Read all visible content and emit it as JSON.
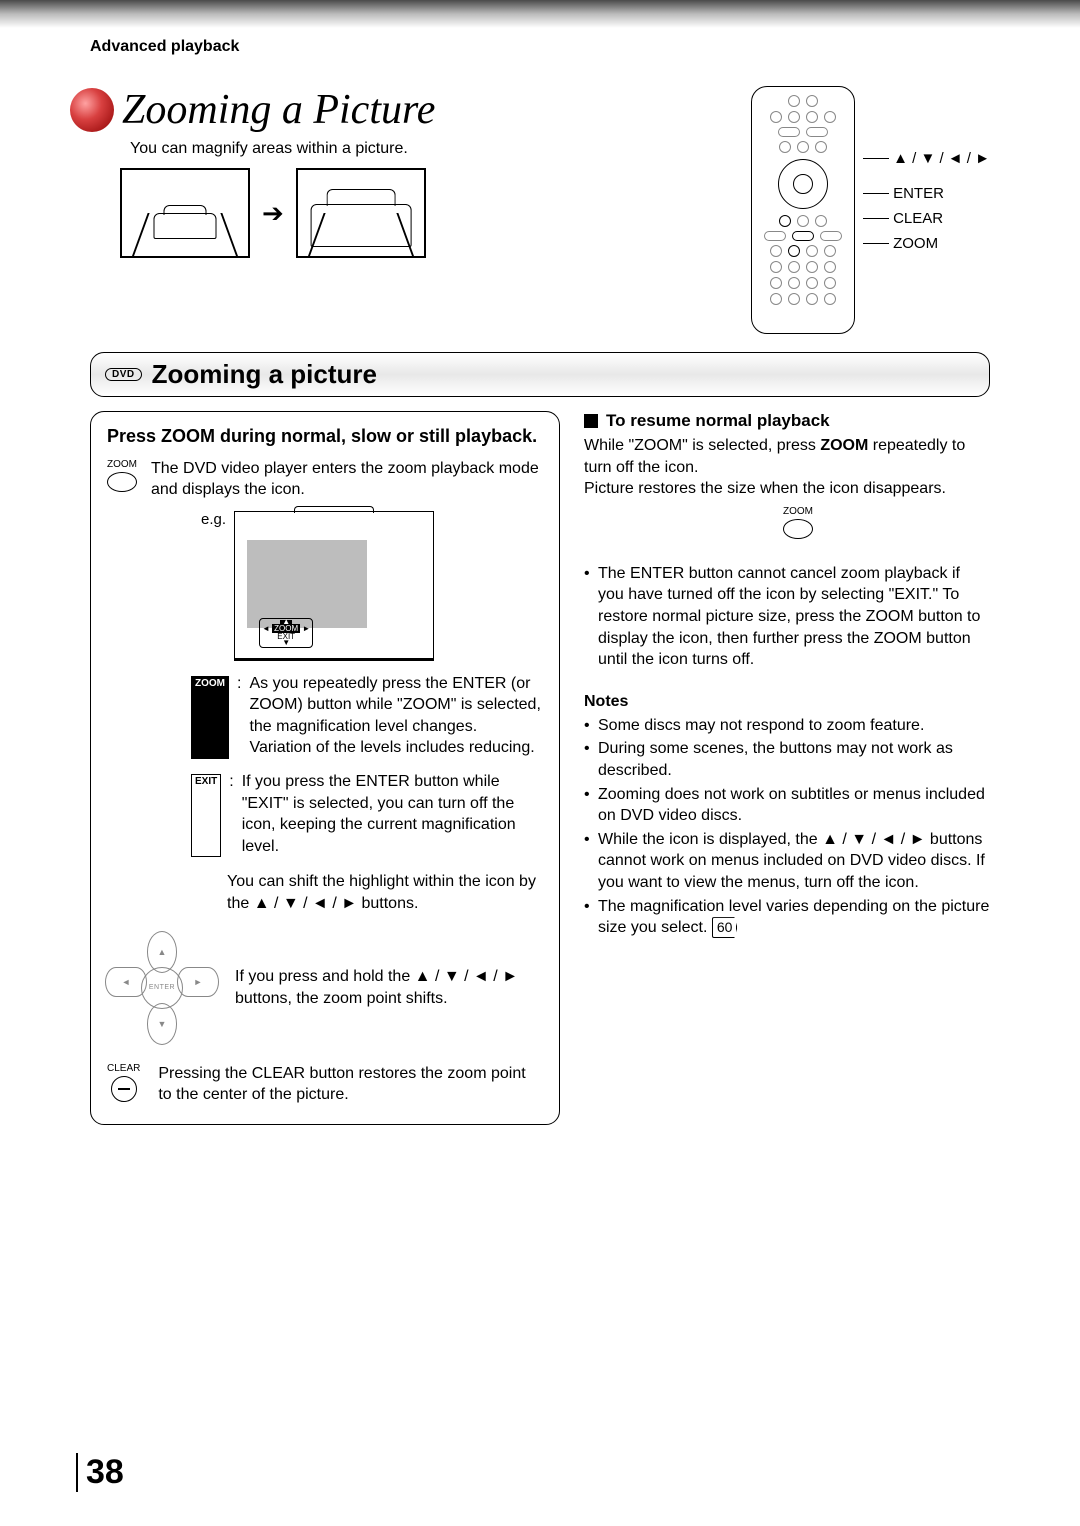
{
  "header": {
    "breadcrumb": "Advanced playback"
  },
  "title": "Zooming a Picture",
  "subtitle": "You can magnify areas within a picture.",
  "remote_labels": {
    "arrows": "▲ / ▼ / ◄ / ►",
    "enter": "ENTER",
    "clear": "CLEAR",
    "zoom": "ZOOM"
  },
  "section": {
    "dvd_badge": "DVD",
    "heading": "Zooming a picture"
  },
  "panel": {
    "heading": "Press ZOOM during normal, slow or still playback.",
    "zoom_label": "ZOOM",
    "step1": "The DVD video player enters the zoom playback mode and displays the icon.",
    "eg": "e.g.",
    "osd_zoom": "ZOOM",
    "osd_exit": "EXIT",
    "zoom_tag": "ZOOM",
    "zoom_def": "As you repeatedly press the ENTER (or ZOOM) button while \"ZOOM\" is selected, the magnification level changes.\nVariation of the levels includes reducing.",
    "exit_tag": "EXIT",
    "exit_def": "If you press the ENTER button while \"EXIT\" is selected, you can turn off the icon, keeping the current magnification level.",
    "shift1": "You can shift the highlight within the icon by the ▲ / ▼ / ◄ / ► buttons.",
    "shift2": "If you press and hold the ▲ / ▼ / ◄ / ► buttons, the zoom point shifts.",
    "dpad_center": "ENTER",
    "clear_label": "CLEAR",
    "clear_text": "Pressing the CLEAR button restores the zoom point to the center of the picture."
  },
  "right": {
    "resume_h": "To resume normal playback",
    "resume_p1": "While \"ZOOM\" is selected, press ZOOM repeatedly to turn off the icon.",
    "resume_p2": "Picture restores the size when the icon disappears.",
    "zoom_label": "ZOOM",
    "bullet1": "The ENTER button cannot cancel zoom playback if you have turned off the icon by selecting \"EXIT.\"  To restore normal picture size, press the ZOOM button to display the icon, then further press the ZOOM button until the icon turns off.",
    "notes_h": "Notes",
    "notes": [
      "Some discs may not respond to zoom feature.",
      "During some scenes, the buttons may not work as described.",
      "Zooming does not work on subtitles or menus included on DVD video discs.",
      "While the icon is displayed, the ▲ / ▼ / ◄ / ► buttons cannot work on menus included on DVD video discs.  If you want to view the menus, turn off the icon.",
      "The magnification level varies depending on the picture size you select."
    ],
    "ref": "60"
  },
  "page_number": "38"
}
